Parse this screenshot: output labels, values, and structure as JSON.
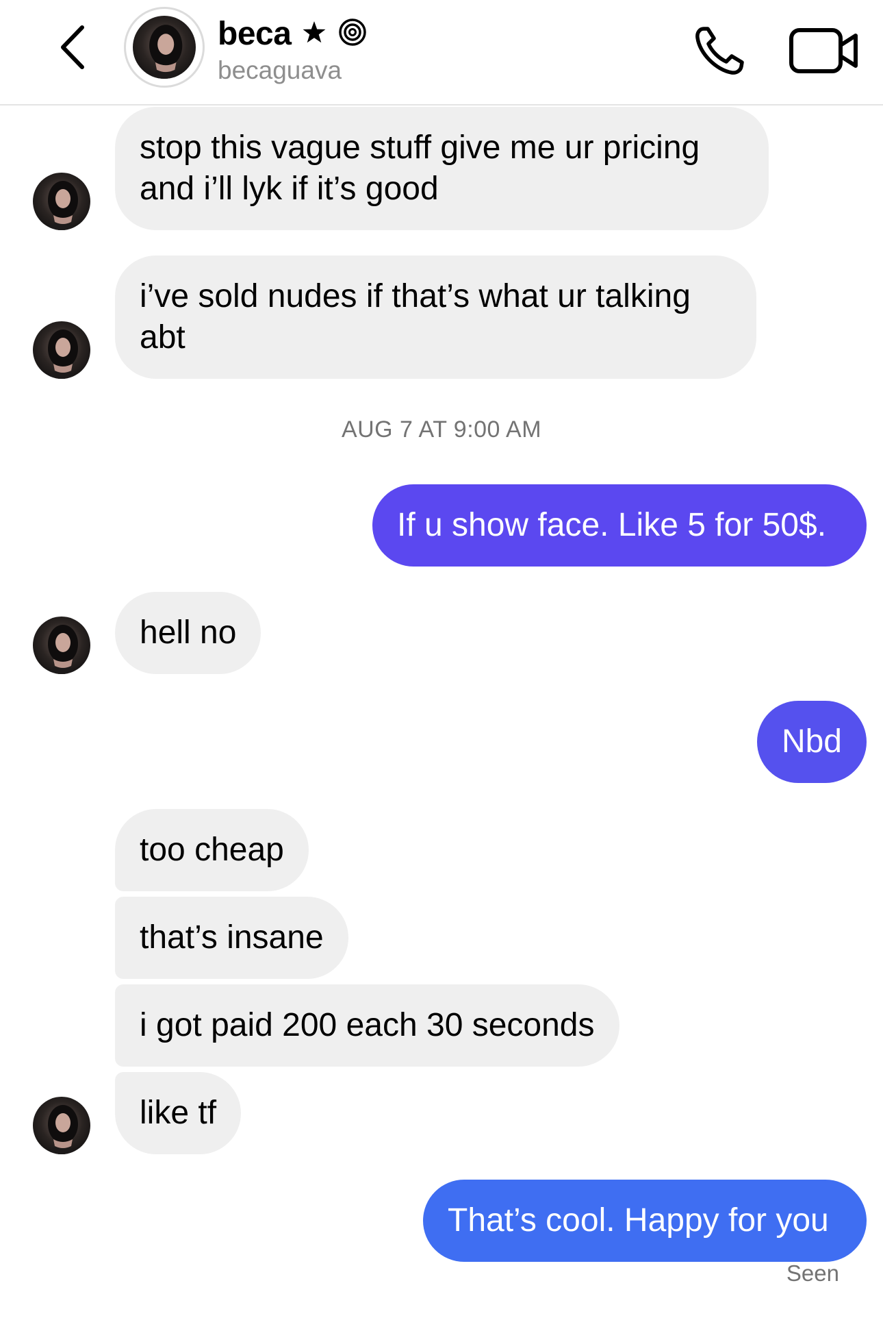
{
  "header": {
    "back_icon": "chevron-left-icon",
    "display_name": "beca",
    "name_icons": [
      "star-icon",
      "threads-icon"
    ],
    "username": "becaguava",
    "call_icon": "phone-icon",
    "video_icon": "video-camera-icon"
  },
  "thread": {
    "messages": [
      {
        "from": "them",
        "text": "stop this vague stuff give me ur pricing\nand i’ll lyk if it’s good"
      },
      {
        "from": "them",
        "text": "i’ve sold nudes if that’s what ur talking\nabt"
      },
      {
        "from": "me",
        "text": "If u show face. Like 5 for 50$.",
        "color": "#5b48f0"
      },
      {
        "from": "them",
        "text": "hell no"
      },
      {
        "from": "me",
        "text": "Nbd",
        "color": "#5551ee"
      },
      {
        "from": "them",
        "text": "too cheap"
      },
      {
        "from": "them",
        "text": "that’s insane"
      },
      {
        "from": "them",
        "text": "i got paid 200 each 30 seconds"
      },
      {
        "from": "them",
        "text": "like tf"
      },
      {
        "from": "me",
        "text": "That’s cool. Happy for you",
        "color": "#3f6ef2"
      }
    ],
    "timestamp": "AUG 7 AT 9:00 AM",
    "seen_label": "Seen"
  },
  "colors": {
    "incoming_bubble": "#efefef",
    "outgoing_top": "#5b48f0",
    "outgoing_bottom": "#3f6ef2",
    "muted_text": "#737373"
  }
}
